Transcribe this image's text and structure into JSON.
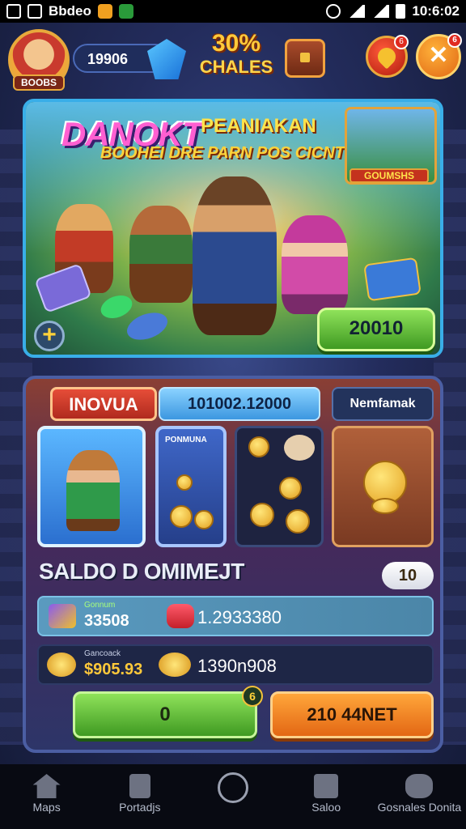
{
  "status_bar": {
    "left_text": "Bbdeo",
    "time": "10:6:02"
  },
  "header": {
    "avatar_label": "BOOBS",
    "coins": "19906",
    "logo_number": "30%",
    "logo_word": "CHALES",
    "heart_badge": "6",
    "close_badge": "6",
    "close_glyph": "✕"
  },
  "banner": {
    "title": "DANOKT",
    "title2": "PEANIAKAN",
    "subtitle": "BOOHEI DRE PARN POS CICNTS",
    "inset_label": "GOUMSHS",
    "plus_glyph": "+",
    "cta_label": "20010"
  },
  "tabs": [
    {
      "label": "INOVUA"
    },
    {
      "label": "101002.12000"
    },
    {
      "label": "Nemfamak"
    }
  ],
  "cards": [
    {
      "label": ""
    },
    {
      "label": "PONMUNA"
    },
    {
      "label": ""
    },
    {
      "label": ""
    }
  ],
  "saldo": {
    "title": "SALDO D OMIMEJT",
    "pill": "10",
    "rows": [
      {
        "small": "Gonnum",
        "value1": "33508",
        "value2": "1.2933380"
      },
      {
        "small": "Gancoack",
        "value1": "$905.93",
        "value2": "1390n908"
      }
    ]
  },
  "actions": {
    "green_label": "0",
    "green_mini": "6",
    "orange_label": "210 44NET"
  },
  "bottom_nav": [
    {
      "label": "Maps"
    },
    {
      "label": "Portadjs"
    },
    {
      "label": ""
    },
    {
      "label": "Saloo"
    },
    {
      "label": "Gosnales Donita"
    }
  ],
  "colors": {
    "accent_blue": "#39aee8",
    "cta_green": "#3f9a22",
    "cta_orange": "#e36714",
    "tab_red": "#e64d38"
  }
}
